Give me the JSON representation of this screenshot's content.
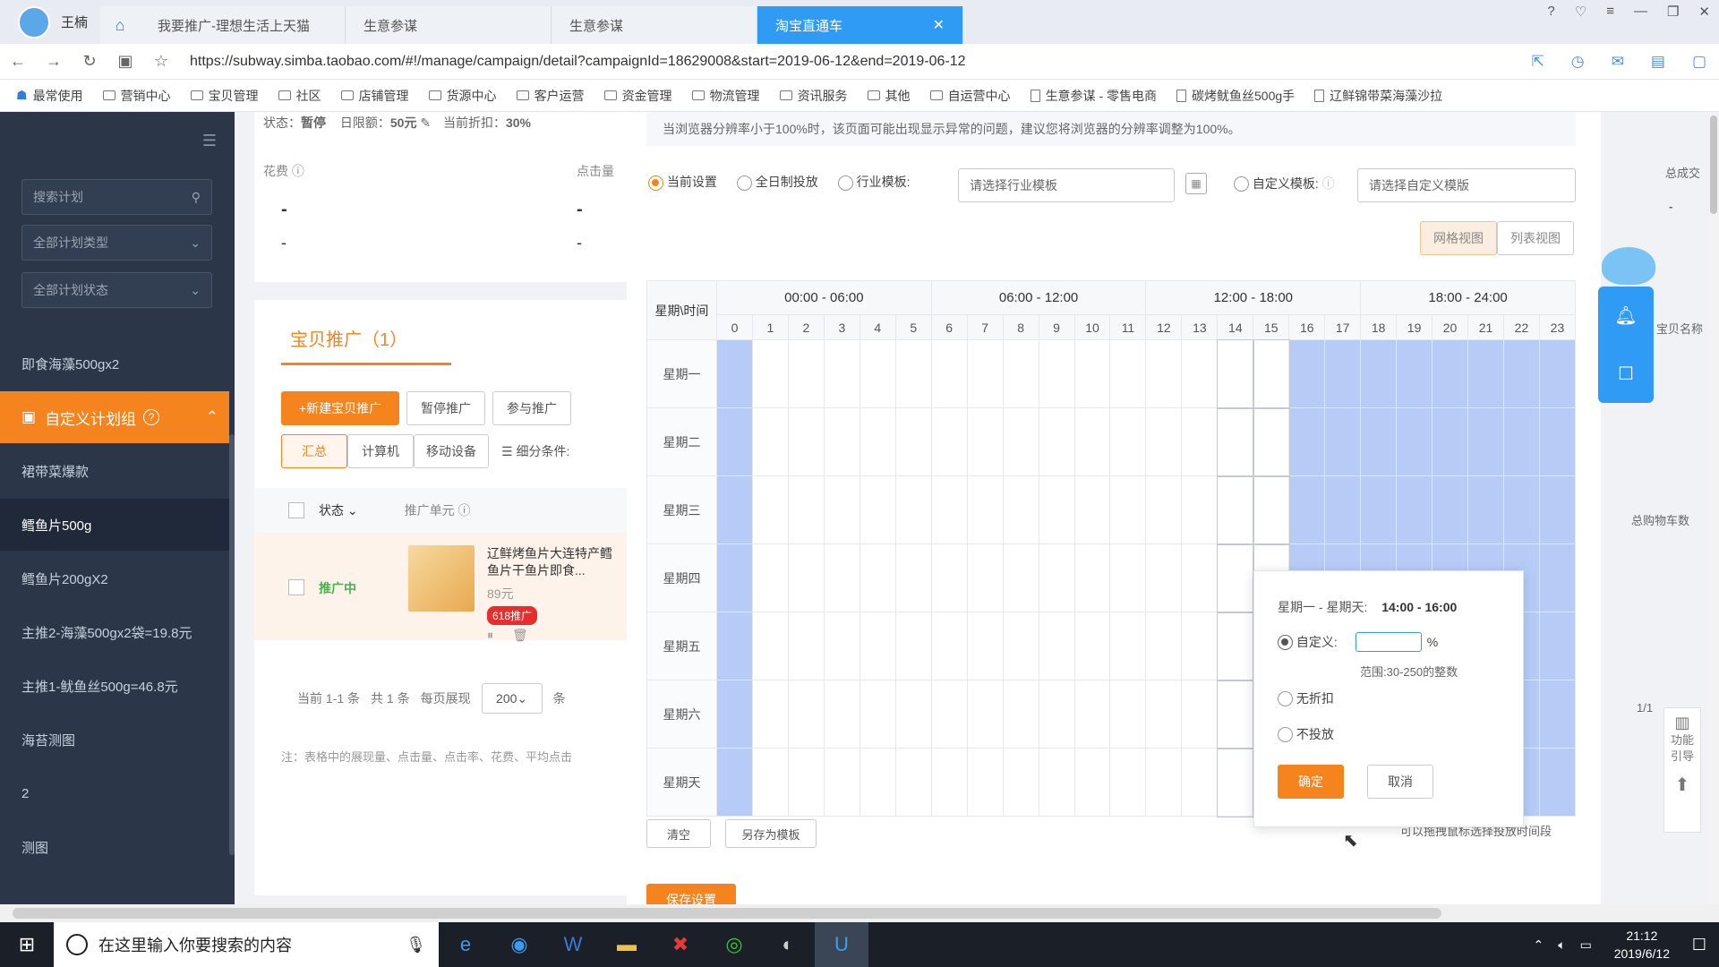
{
  "browser": {
    "user_name": "王楠",
    "tabs": [
      {
        "label": "我要推广-理想生活上天猫"
      },
      {
        "label": "生意参谋"
      },
      {
        "label": "生意参谋"
      },
      {
        "label": "淘宝直通车"
      }
    ],
    "url": "https://subway.simba.taobao.com/#!/manage/campaign/detail?campaignId=18629008&start=2019-06-12&end=2019-06-12",
    "bookmarks": [
      "最常使用",
      "营销中心",
      "宝贝管理",
      "社区",
      "店铺管理",
      "货源中心",
      "客户运营",
      "资金管理",
      "物流管理",
      "资讯服务",
      "其他",
      "自运营中心",
      "生意参谋 - 零售电商",
      "碳烤鱿鱼丝500g手",
      "辽鲜锦带菜海藻沙拉"
    ]
  },
  "sidebar": {
    "search_placeholder": "搜索计划",
    "plan_type": "全部计划类型",
    "plan_status": "全部计划状态",
    "items_top": [
      "即食海藻500gx2"
    ],
    "group_label": "自定义计划组",
    "items": [
      "裙带菜爆款",
      "鳕鱼片500g",
      "鳕鱼片200gX2",
      "主推2-海藻500gx2袋=19.8元",
      "主推1-鱿鱼丝500g=46.8元",
      "海苔测图",
      "2",
      "测图"
    ],
    "selected_item": "鳕鱼片500g"
  },
  "background": {
    "status_line": {
      "status_label": "状态：",
      "status": "暂停",
      "budget_label": "日限额：",
      "budget": "50元",
      "discount_label": "当前折扣：",
      "discount": "30%"
    },
    "metrics": [
      {
        "label": "花费",
        "v1": "-",
        "v2": "-"
      },
      {
        "label": "点击量",
        "v1": "-",
        "v2": "-"
      }
    ],
    "section_title": "宝贝推广（1）",
    "buttons": [
      "新建宝贝推广",
      "暂停推广",
      "参与推广"
    ],
    "view_tabs": [
      "汇总",
      "计算机",
      "移动设备"
    ],
    "filter_label": "细分条件:",
    "table_headers": [
      "状态",
      "推广单元"
    ],
    "row": {
      "status": "推广中",
      "title": "辽鲜烤鱼片大连特产鳕鱼片干鱼片即食...",
      "price": "89元",
      "badge": "618推广"
    },
    "pagination": {
      "text": "当前 1-1 条",
      "total": "共 1 条",
      "per_page_label": "每页展现",
      "per_page": "200",
      "unit": "条"
    },
    "footnote": "注：表格中的展现量、点击量、点击率、花费、平均点击"
  },
  "panel": {
    "notice": "当浏览器分辨率小于100%时，该页面可能出现显示异常的问题，建议您将浏览器的分辨率调整为100%。",
    "modes": {
      "current": "当前设置",
      "all_day": "全日制投放",
      "industry": "行业模板:",
      "industry_placeholder": "请选择行业模板",
      "custom": "自定义模板:",
      "custom_placeholder": "请选择自定义模版"
    },
    "view_toggle": [
      "网格视图",
      "列表视图"
    ],
    "corner_label": "星期\\时间",
    "time_ranges": [
      "00:00 - 06:00",
      "06:00 - 12:00",
      "12:00 - 18:00",
      "18:00 - 24:00"
    ],
    "hours": [
      "0",
      "1",
      "2",
      "3",
      "4",
      "5",
      "6",
      "7",
      "8",
      "9",
      "10",
      "11",
      "12",
      "13",
      "14",
      "15",
      "16",
      "17",
      "18",
      "19",
      "20",
      "21",
      "22",
      "23"
    ],
    "days": [
      "星期一",
      "星期二",
      "星期三",
      "星期四",
      "星期五",
      "星期六",
      "星期天"
    ],
    "active_hours": [
      0,
      16,
      17,
      18,
      19,
      20,
      21,
      22,
      23
    ],
    "selected_hours": [
      14,
      15
    ],
    "buttons": {
      "clear": "清空",
      "save_template": "另存为模板",
      "save": "保存设置"
    },
    "hint": "可以拖拽鼠标选择投放时间段",
    "right_labels": {
      "total": "总成交",
      "item_name": "宝贝名称",
      "cart": "总购物车数",
      "page": "1/1"
    }
  },
  "popup": {
    "range": "星期一 - 星期天:",
    "time": "14:00 - 16:00",
    "custom_label": "自定义:",
    "custom_value": "",
    "percent": "%",
    "range_hint": "范围:30-250的整数",
    "no_discount": "无折扣",
    "no_delivery": "不投放",
    "confirm": "确定",
    "cancel": "取消"
  },
  "float": {
    "guide": "功能引导"
  },
  "taskbar": {
    "search_placeholder": "在这里输入你要搜索的内容",
    "time": "21:12",
    "date": "2019/6/12"
  },
  "colors": {
    "accent": "#f5841f",
    "selected_cell": "#b6ccf7",
    "sidebar": "#2b3648",
    "tab_active": "#2f9bf5"
  }
}
